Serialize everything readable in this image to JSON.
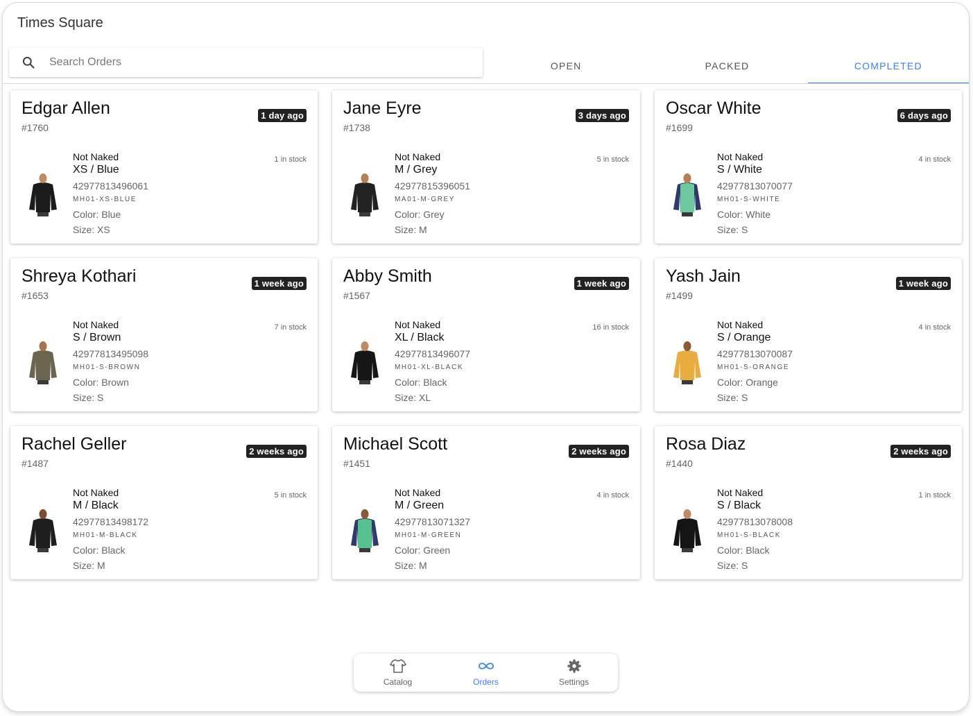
{
  "app": {
    "title": "Times Square"
  },
  "search": {
    "placeholder": "Search Orders",
    "value": ""
  },
  "tabs": [
    {
      "label": "OPEN",
      "active": false
    },
    {
      "label": "PACKED",
      "active": false
    },
    {
      "label": "COMPLETED",
      "active": true
    }
  ],
  "orders": [
    {
      "customer": "Edgar Allen",
      "order_number": "#1760",
      "age": "1 day ago",
      "vendor": "Not Naked",
      "variant": "XS / Blue",
      "barcode": "42977813496061",
      "sku": "MH01-XS-BLUE",
      "color": "Color: Blue",
      "size": "Size: XS",
      "stock": "1 in stock",
      "body_color": "#1b1b1b",
      "sleeve_color": "#1b1b1b",
      "skin_color": "#c08a62"
    },
    {
      "customer": "Jane Eyre",
      "order_number": "#1738",
      "age": "3 days ago",
      "vendor": "Not Naked",
      "variant": "M / Grey",
      "barcode": "42977815396051",
      "sku": "MA01-M-GREY",
      "color": "Color: Grey",
      "size": "Size: M",
      "stock": "5 in stock",
      "body_color": "#222222",
      "sleeve_color": "#222222",
      "skin_color": "#b57f58"
    },
    {
      "customer": "Oscar White",
      "order_number": "#1699",
      "age": "6 days ago",
      "vendor": "Not Naked",
      "variant": "S / White",
      "barcode": "42977813070077",
      "sku": "MH01-S-WHITE",
      "color": "Color: White",
      "size": "Size: S",
      "stock": "4 in stock",
      "body_color": "#6fc9a0",
      "sleeve_color": "#2d3a6b",
      "skin_color": "#b57f58"
    },
    {
      "customer": "Shreya Kothari",
      "order_number": "#1653",
      "age": "1 week ago",
      "vendor": "Not Naked",
      "variant": "S / Brown",
      "barcode": "42977813495098",
      "sku": "MH01-S-BROWN",
      "color": "Color: Brown",
      "size": "Size: S",
      "stock": "7 in stock",
      "body_color": "#6b6550",
      "sleeve_color": "#6b6550",
      "skin_color": "#a8744f"
    },
    {
      "customer": "Abby Smith",
      "order_number": "#1567",
      "age": "1 week ago",
      "vendor": "Not Naked",
      "variant": "XL / Black",
      "barcode": "42977813496077",
      "sku": "MH01-XL-BLACK",
      "color": "Color: Black",
      "size": "Size: XL",
      "stock": "16 in stock",
      "body_color": "#161616",
      "sleeve_color": "#161616",
      "skin_color": "#c08a62"
    },
    {
      "customer": "Yash Jain",
      "order_number": "#1499",
      "age": "1 week ago",
      "vendor": "Not Naked",
      "variant": "S / Orange",
      "barcode": "42977813070087",
      "sku": "MH01-S-ORANGE",
      "color": "Color: Orange",
      "size": "Size: S",
      "stock": "4 in stock",
      "body_color": "#e9ad3f",
      "sleeve_color": "#e9ad3f",
      "skin_color": "#8a5a38"
    },
    {
      "customer": "Rachel Geller",
      "order_number": "#1487",
      "age": "2 weeks ago",
      "vendor": "Not Naked",
      "variant": "M / Black",
      "barcode": "42977813498172",
      "sku": "MH01-M-BLACK",
      "color": "Color: Black",
      "size": "Size: M",
      "stock": "5 in stock",
      "body_color": "#1e1e1e",
      "sleeve_color": "#1e1e1e",
      "skin_color": "#7a4d30"
    },
    {
      "customer": "Michael Scott",
      "order_number": "#1451",
      "age": "2 weeks ago",
      "vendor": "Not Naked",
      "variant": "M / Green",
      "barcode": "42977813071327",
      "sku": "MH01-M-GREEN",
      "color": "Color: Green",
      "size": "Size: M",
      "stock": "4 in stock",
      "body_color": "#57c08f",
      "sleeve_color": "#2d3a6b",
      "skin_color": "#8a5a38"
    },
    {
      "customer": "Rosa Diaz",
      "order_number": "#1440",
      "age": "2 weeks ago",
      "vendor": "Not Naked",
      "variant": "S / Black",
      "barcode": "42977813078008",
      "sku": "MH01-S-BLACK",
      "color": "Color: Black",
      "size": "Size: S",
      "stock": "1 in stock",
      "body_color": "#141414",
      "sleeve_color": "#141414",
      "skin_color": "#c08a62"
    }
  ],
  "bottom_nav": [
    {
      "label": "Catalog",
      "icon": "shirt-icon",
      "active": false
    },
    {
      "label": "Orders",
      "icon": "infinity-icon",
      "active": true
    },
    {
      "label": "Settings",
      "icon": "gear-icon",
      "active": false
    }
  ],
  "colors": {
    "accent": "#3880ff",
    "badge": "#222222"
  }
}
